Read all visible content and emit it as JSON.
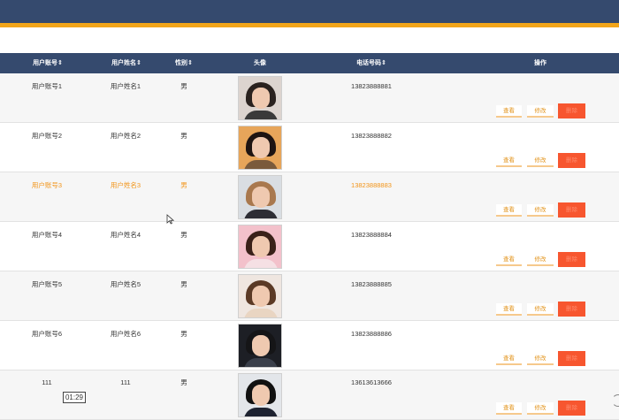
{
  "breadcrumb": "",
  "table": {
    "headers": {
      "account": "用户账号",
      "name": "用户姓名",
      "gender": "性别",
      "avatar": "头像",
      "phone": "电话号码",
      "actions": "操作"
    },
    "sort_mark": "⇕",
    "buttons": {
      "view": "查看",
      "edit": "修改",
      "delete": "删除"
    },
    "rows": [
      {
        "account": "用户账号1",
        "name": "用户姓名1",
        "gender": "男",
        "phone": "13823888881",
        "avatar_icon": "person-photo-1"
      },
      {
        "account": "用户账号2",
        "name": "用户姓名2",
        "gender": "男",
        "phone": "13823888882",
        "avatar_icon": "person-photo-2"
      },
      {
        "account": "用户账号3",
        "name": "用户姓名3",
        "gender": "男",
        "phone": "13823888883",
        "avatar_icon": "person-photo-3"
      },
      {
        "account": "用户账号4",
        "name": "用户姓名4",
        "gender": "男",
        "phone": "13823888884",
        "avatar_icon": "person-photo-4"
      },
      {
        "account": "用户账号5",
        "name": "用户姓名5",
        "gender": "男",
        "phone": "13823888885",
        "avatar_icon": "person-photo-5"
      },
      {
        "account": "用户账号6",
        "name": "用户姓名6",
        "gender": "男",
        "phone": "13823888886",
        "avatar_icon": "person-photo-6"
      },
      {
        "account": "111",
        "name": "111",
        "gender": "男",
        "phone": "13613613666",
        "avatar_icon": "person-photo-7"
      }
    ]
  },
  "video_timer": "01:29",
  "colors": {
    "header_bg": "#354a6e",
    "accent_bar": "#f2a51a",
    "highlight_text": "#f29418",
    "delete_button": "#f7562f"
  }
}
